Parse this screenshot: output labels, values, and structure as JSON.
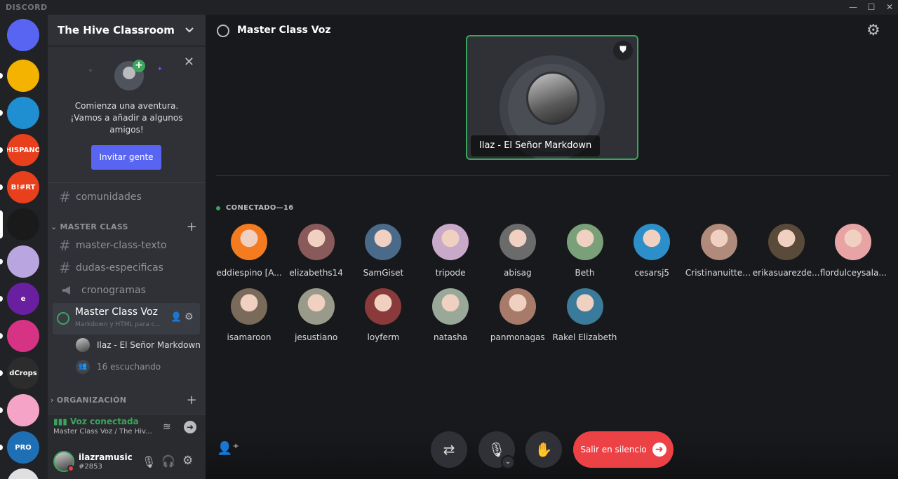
{
  "app": {
    "brand": "DISCORD"
  },
  "window": {
    "minimize": "—",
    "maximize": "☐",
    "close": "✕"
  },
  "colors": {
    "accent": "#5865f2",
    "online": "#3ba55d",
    "danger": "#ed4245",
    "bg_main": "#18191c",
    "bg_sidebar": "#2f3136"
  },
  "server": {
    "name": "The Hive Classroom"
  },
  "invite_card": {
    "text": "Comienza una aventura. ¡Vamos a añadir a algunos amigos!",
    "button": "Invitar gente"
  },
  "channels": {
    "top": [
      {
        "label": "comunidades",
        "icon": "hash-icon"
      }
    ],
    "master_class": {
      "category": "MASTER CLASS",
      "items": [
        {
          "label": "master-class-texto",
          "icon": "hash-icon"
        },
        {
          "label": "dudas-especificas",
          "icon": "hash-icon"
        },
        {
          "label": "cronogramas",
          "icon": "megaphone-icon"
        }
      ],
      "voice": {
        "title": "Master Class Voz",
        "subtitle": "Markdown y HTML para c...",
        "speaker": "Ilaz - El Señor Markdown",
        "listening": "16 escuchando"
      }
    },
    "organizacion": {
      "category": "ORGANIZACIÓN"
    }
  },
  "voice_status": {
    "status": "Voz conectada",
    "location": "Master Class Voz / The Hiv..."
  },
  "user": {
    "name": "ilazramusic",
    "tag": "#2853"
  },
  "stage": {
    "title": "Master Class Voz",
    "speaker_name": "Ilaz - El Señor Markdown",
    "connected_header": "CONECTADO—16",
    "audience": [
      {
        "name": "eddiespino [A...",
        "color": "#f47b20"
      },
      {
        "name": "elizabeths14",
        "color": "#8a5a5a"
      },
      {
        "name": "SamGiset",
        "color": "#4a6a8a"
      },
      {
        "name": "tripode",
        "color": "#c9a9c9"
      },
      {
        "name": "abisag",
        "color": "#6b6b6b"
      },
      {
        "name": "Beth",
        "color": "#7aa07a"
      },
      {
        "name": "cesarsj5",
        "color": "#2d8fc9"
      },
      {
        "name": "Cristinanuitter...",
        "color": "#b08a7a"
      },
      {
        "name": "erikasuarezde...",
        "color": "#5a4a3a"
      },
      {
        "name": "flordulceysala...",
        "color": "#e8a4a4"
      },
      {
        "name": "isamaroon",
        "color": "#7a6a5a"
      },
      {
        "name": "jesustiano",
        "color": "#9a9a8a"
      },
      {
        "name": "loyferm",
        "color": "#8a3a3a"
      },
      {
        "name": "natasha",
        "color": "#9aa89a"
      },
      {
        "name": "panmonagas",
        "color": "#a87a6a"
      },
      {
        "name": "Rakel Elizabeth",
        "color": "#3a7a9a"
      }
    ],
    "leave_button": "Salir en silencio"
  },
  "guilds": [
    {
      "label": "",
      "color": "#5865f2",
      "icon": "discord-logo-icon"
    },
    {
      "label": "",
      "color": "#f5b301",
      "icon": "smile-icon"
    },
    {
      "label": "",
      "color": "#1f8fd1",
      "icon": "eight-icon"
    },
    {
      "label": "HISPANO",
      "color": "#e8401c"
    },
    {
      "label": "B!#RT",
      "color": "#e8401c"
    },
    {
      "label": "",
      "color": "#1a1a1a",
      "icon": "hive-classroom-icon"
    },
    {
      "label": "",
      "color": "#b9a6e0"
    },
    {
      "label": "e",
      "color": "#6a1fa0"
    },
    {
      "label": "",
      "color": "#d63384"
    },
    {
      "label": "dCrops",
      "color": "#2c2c2c"
    },
    {
      "label": "",
      "color": "#f5a3c7"
    },
    {
      "label": "PRO",
      "color": "#1f6fb5"
    },
    {
      "label": "",
      "color": "#e0e0e0"
    }
  ]
}
